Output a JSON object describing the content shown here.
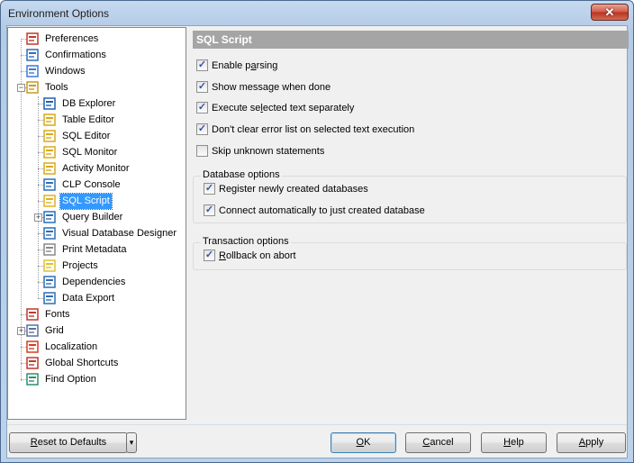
{
  "window": {
    "title": "Environment Options",
    "close_label": "✕"
  },
  "tree": {
    "items": [
      {
        "label": "Preferences",
        "icon": "preferences-icon"
      },
      {
        "label": "Confirmations",
        "icon": "confirmations-icon"
      },
      {
        "label": "Windows",
        "icon": "windows-icon"
      },
      {
        "label": "Tools",
        "icon": "tools-icon"
      },
      {
        "label": "DB Explorer",
        "icon": "db-explorer-icon"
      },
      {
        "label": "Table Editor",
        "icon": "table-editor-icon"
      },
      {
        "label": "SQL Editor",
        "icon": "sql-editor-icon"
      },
      {
        "label": "SQL Monitor",
        "icon": "sql-monitor-icon"
      },
      {
        "label": "Activity Monitor",
        "icon": "activity-monitor-icon"
      },
      {
        "label": "CLP Console",
        "icon": "clp-console-icon"
      },
      {
        "label": "SQL Script",
        "icon": "sql-script-icon"
      },
      {
        "label": "Query Builder",
        "icon": "query-builder-icon"
      },
      {
        "label": "Visual Database Designer",
        "icon": "visual-database-designer-icon"
      },
      {
        "label": "Print Metadata",
        "icon": "printer-icon"
      },
      {
        "label": "Projects",
        "icon": "projects-folder-icon"
      },
      {
        "label": "Dependencies",
        "icon": "dependencies-icon"
      },
      {
        "label": "Data Export",
        "icon": "data-export-icon"
      },
      {
        "label": "Fonts",
        "icon": "fonts-icon"
      },
      {
        "label": "Grid",
        "icon": "grid-icon"
      },
      {
        "label": "Localization",
        "icon": "localization-icon"
      },
      {
        "label": "Global Shortcuts",
        "icon": "global-shortcuts-icon"
      },
      {
        "label": "Find Option",
        "icon": "find-option-icon"
      }
    ],
    "selected": "SQL Script"
  },
  "panel": {
    "title": "SQL Script",
    "options": [
      {
        "label_pre": "Enable p",
        "label_u": "a",
        "label_post": "rsing",
        "checked": true
      },
      {
        "label_pre": "Show message when done",
        "label_u": "",
        "label_post": "",
        "checked": true
      },
      {
        "label_pre": "Execute se",
        "label_u": "l",
        "label_post": "ected text separately",
        "checked": true
      },
      {
        "label_pre": "Don't clear error list on selected text execution",
        "label_u": "",
        "label_post": "",
        "checked": true
      },
      {
        "label_pre": "Skip unknown statements",
        "label_u": "",
        "label_post": "",
        "checked": false
      }
    ],
    "database_options": {
      "title": "Database options",
      "options": [
        {
          "label": "Register newly created databases",
          "checked": true
        },
        {
          "label": "Connect automatically to just created database",
          "checked": true
        }
      ]
    },
    "transaction_options": {
      "title": "Transaction options",
      "options": [
        {
          "label_u": "R",
          "label_post": "ollback on abort",
          "checked": true
        }
      ]
    }
  },
  "buttons": {
    "reset_u": "R",
    "reset_post": "eset to Defaults",
    "reset_dropdown": "▾",
    "ok_u": "O",
    "ok_post": "K",
    "cancel_u": "C",
    "cancel_post": "ancel",
    "help_u": "H",
    "help_post": "elp",
    "apply_u": "A",
    "apply_post": "pply"
  },
  "check_glyph": "✓"
}
